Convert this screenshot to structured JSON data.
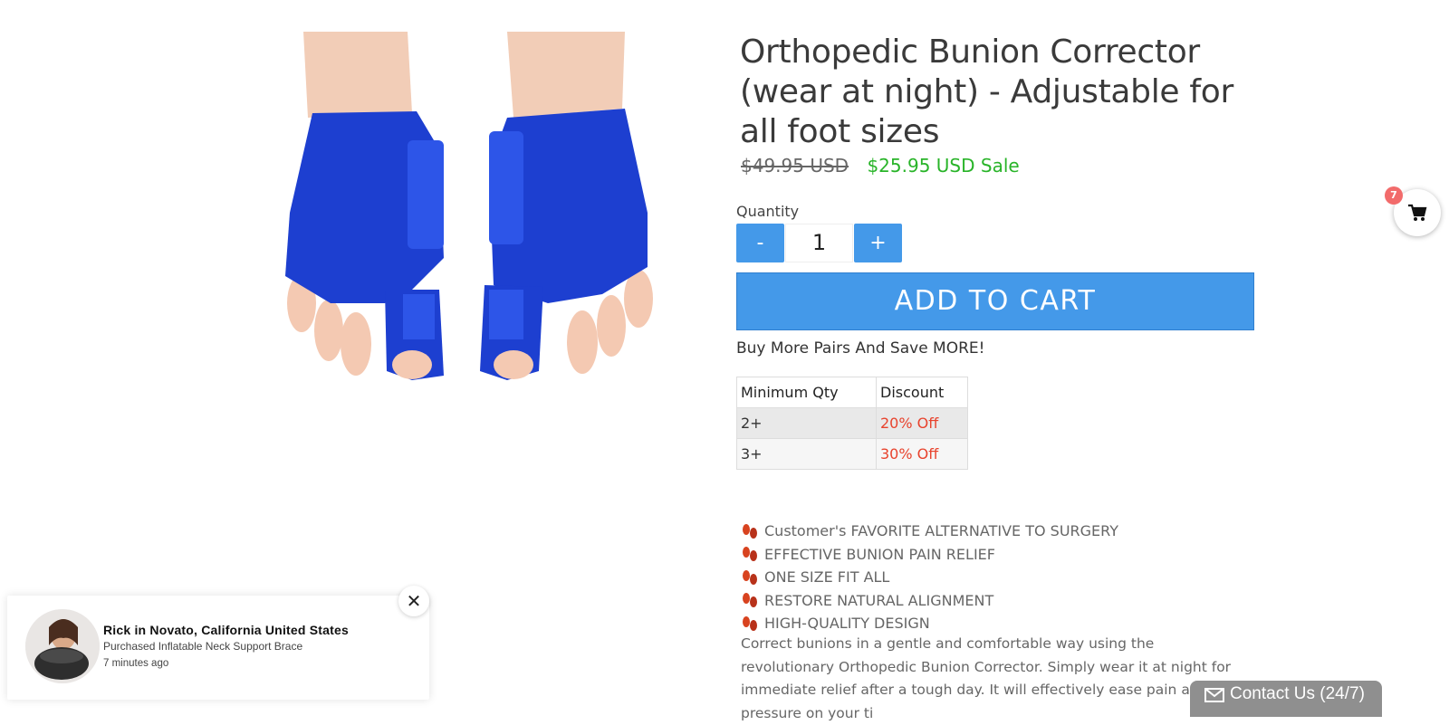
{
  "product": {
    "title": "Orthopedic Bunion Corrector (wear at night) - Adjustable for all foot sizes",
    "old_price": "$49.95 USD",
    "new_price": "$25.95 USD",
    "sale_label": "Sale",
    "image_icon": "bunion-corrector-photo"
  },
  "quantity": {
    "label": "Quantity",
    "minus_label": "-",
    "plus_label": "+",
    "value": "1"
  },
  "cart": {
    "add_label": "ADD TO CART",
    "badge_count": "7",
    "icon": "cart-icon"
  },
  "bulk": {
    "title": "Buy More Pairs And Save MORE!",
    "headers": [
      "Minimum Qty",
      "Discount"
    ],
    "rows": [
      {
        "qty": "2+",
        "discount": "20% Off"
      },
      {
        "qty": "3+",
        "discount": "30% Off"
      }
    ]
  },
  "features": [
    "Customer's FAVORITE ALTERNATIVE TO SURGERY",
    "EFFECTIVE BUNION PAIN RELIEF",
    "ONE SIZE FIT ALL",
    "RESTORE NATURAL ALIGNMENT",
    "HIGH-QUALITY DESIGN"
  ],
  "description": "Correct bunions in a gentle and comfortable way using the revolutionary Orthopedic Bunion Corrector. Simply wear it at night for immediate relief after a tough day. It will effectively ease pain and pressure on your ti",
  "popup": {
    "name": "Rick in Novato, California United States",
    "item": "Purchased Inflatable Neck Support Brace",
    "time": "7 minutes ago",
    "close_label": "✕"
  },
  "contact": {
    "label": "Contact Us (24/7)"
  },
  "colors": {
    "accent_blue": "#4499e9",
    "sale_green": "#29b429",
    "discount_red": "#e8432d"
  }
}
